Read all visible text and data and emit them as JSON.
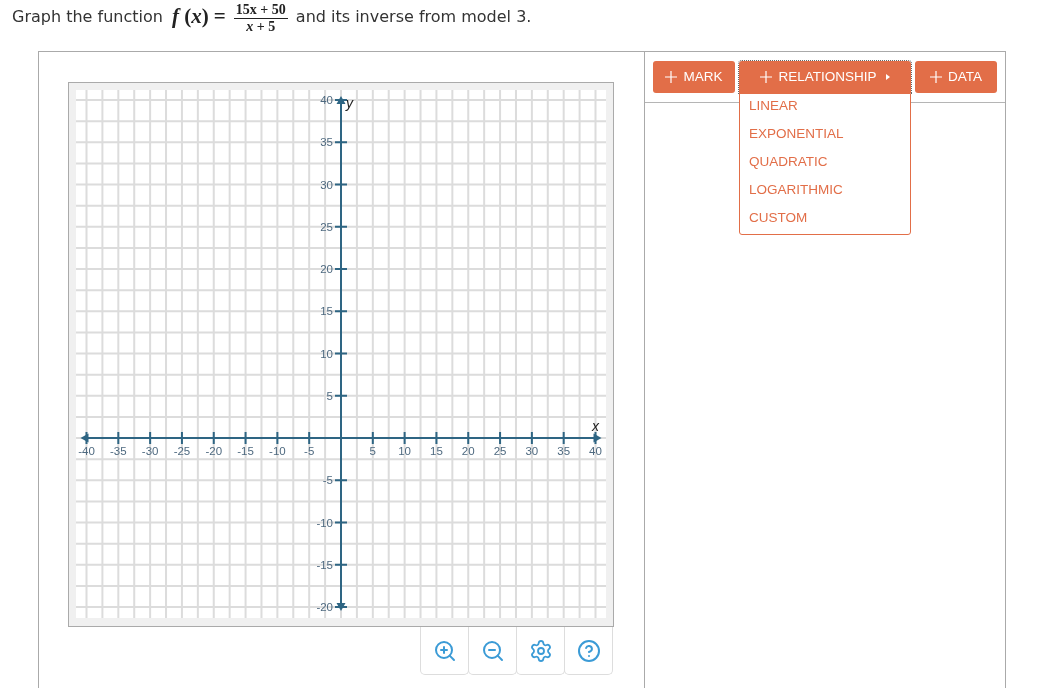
{
  "prompt": {
    "lead": "Graph the function",
    "function_lhs": "*f* (*x*) =",
    "numerator": "15x + 50",
    "denominator": "*x* + 5",
    "tail": "and its inverse from model 3."
  },
  "graph": {
    "chart_data": {
      "type": "line",
      "xlabel": "x",
      "ylabel": "y",
      "xlim": [
        -40,
        40
      ],
      "ylim": [
        -20,
        40
      ],
      "xticks": [
        -40,
        -35,
        -30,
        -25,
        -20,
        -15,
        -10,
        -5,
        5,
        10,
        15,
        20,
        25,
        30,
        35,
        40
      ],
      "yticks": [
        40,
        35,
        30,
        25,
        20,
        15,
        10,
        5,
        -5,
        -10,
        -15,
        -20
      ],
      "grid": true
    }
  },
  "toolbar": {
    "buttons": [
      {
        "label": "MARK",
        "kind": "action",
        "expanded": false
      },
      {
        "label": "RELATIONSHIP",
        "kind": "menu",
        "expanded": true,
        "menu_items": [
          "LINEAR",
          "EXPONENTIAL",
          "QUADRATIC",
          "LOGARITHMIC",
          "CUSTOM"
        ]
      },
      {
        "label": "DATA",
        "kind": "action",
        "expanded": false
      }
    ]
  }
}
